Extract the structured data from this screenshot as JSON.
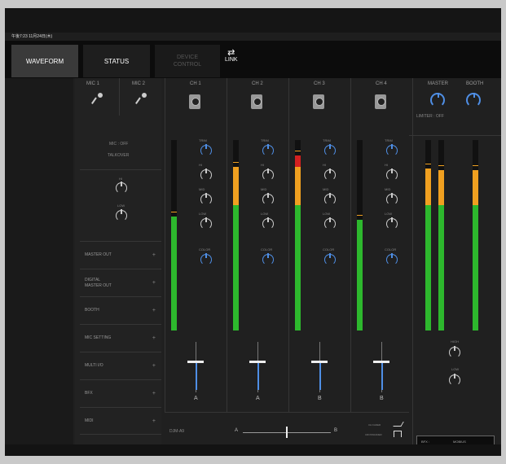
{
  "status": {
    "time_date": "午後7:23  11月24日(木)"
  },
  "tabs": {
    "waveform": "WAVEFORM",
    "status": "STATUS",
    "device_control_line1": "DEVICE",
    "device_control_line2": "CONTROL",
    "link": "LINK"
  },
  "mic": {
    "mic1": "MIC 1",
    "mic2": "MIC 2",
    "mic_state": "MIC : OFF",
    "talkover": "TALKOVER",
    "hi": "HI",
    "low": "LOW"
  },
  "menu": [
    {
      "label": "MASTER OUT"
    },
    {
      "label": "DIGITAL\nMASTER OUT"
    },
    {
      "label": "BOOTH"
    },
    {
      "label": "MIC SETTING"
    },
    {
      "label": "MULTI I/O"
    },
    {
      "label": "BFX"
    },
    {
      "label": "MIDI"
    }
  ],
  "plus": "+",
  "channels": [
    {
      "name": "CH 1",
      "assign": "A",
      "level": 0.6,
      "peak": 0.08
    },
    {
      "name": "CH 2",
      "assign": "A",
      "level": 0.86,
      "peak": 0.05
    },
    {
      "name": "CH 3",
      "assign": "B",
      "level": 0.92,
      "peak": 0.03
    },
    {
      "name": "CH 4",
      "assign": "B",
      "level": 0.58,
      "peak": 0.1
    }
  ],
  "knobs": {
    "trim": "TRIM",
    "hi": "HI",
    "mid": "MID",
    "low": "LOW",
    "color": "COLOR"
  },
  "master": {
    "master": "MASTER",
    "booth": "BOOTH",
    "limiter": "LIMITER : OFF",
    "hi": "HIGH",
    "low": "LOW",
    "level_l": 0.85,
    "level_r": 0.84,
    "level_booth": 0.84
  },
  "crossfader": {
    "model": "DJM-A9",
    "left": "A",
    "right": "B",
    "position": 0.5,
    "ch_fader": "CH FADER",
    "crossfader": "CROSSFADER"
  },
  "fx": {
    "label": "BFX :",
    "value": "MOBIUS"
  },
  "colors": {
    "accent": "#4f8fe6",
    "green": "#2db82d",
    "orange": "#f0a020",
    "red": "#d42020"
  }
}
